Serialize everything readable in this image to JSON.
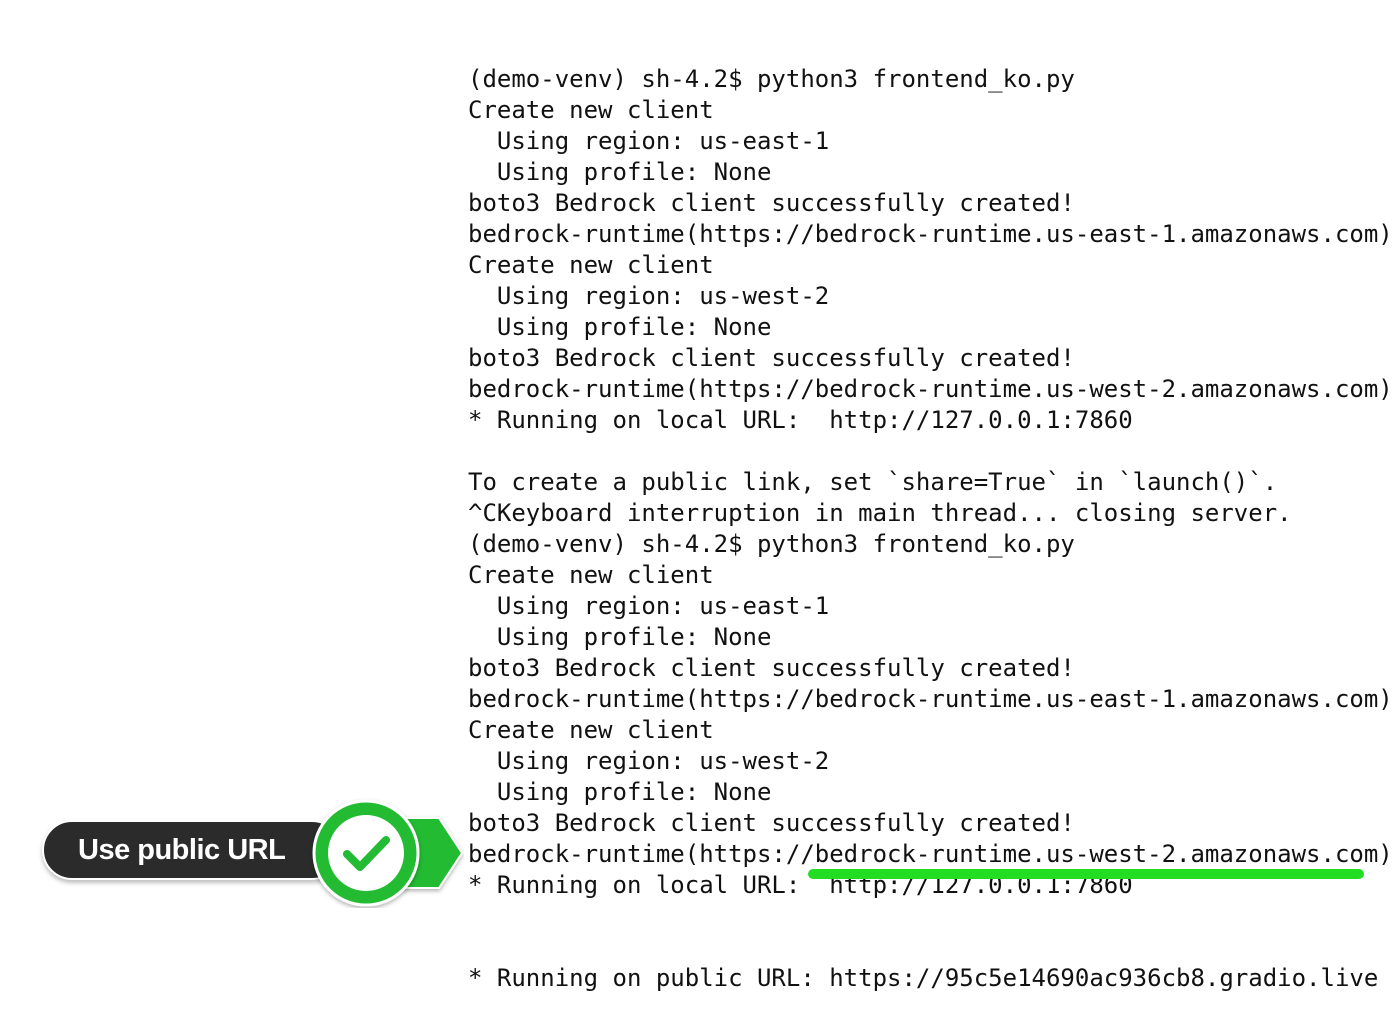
{
  "terminal": {
    "lines": [
      "(demo-venv) sh-4.2$ python3 frontend_ko.py",
      "Create new client",
      "  Using region: us-east-1",
      "  Using profile: None",
      "boto3 Bedrock client successfully created!",
      "bedrock-runtime(https://bedrock-runtime.us-east-1.amazonaws.com)",
      "Create new client",
      "  Using region: us-west-2",
      "  Using profile: None",
      "boto3 Bedrock client successfully created!",
      "bedrock-runtime(https://bedrock-runtime.us-west-2.amazonaws.com)",
      "* Running on local URL:  http://127.0.0.1:7860",
      "",
      "To create a public link, set `share=True` in `launch()`.",
      "^CKeyboard interruption in main thread... closing server.",
      "(demo-venv) sh-4.2$ python3 frontend_ko.py",
      "Create new client",
      "  Using region: us-east-1",
      "  Using profile: None",
      "boto3 Bedrock client successfully created!",
      "bedrock-runtime(https://bedrock-runtime.us-east-1.amazonaws.com)",
      "Create new client",
      "  Using region: us-west-2",
      "  Using profile: None",
      "boto3 Bedrock client successfully created!",
      "bedrock-runtime(https://bedrock-runtime.us-west-2.amazonaws.com)",
      "* Running on local URL:  http://127.0.0.1:7860"
    ],
    "public_prefix": "* Running on public URL: ",
    "public_url": "https://95c5e14690ac936cb8.gradio.live"
  },
  "callout": {
    "label": "Use public URL",
    "icon": "checkmark-icon",
    "accent_color": "#22bb33",
    "underline_color": "#22dd22"
  }
}
